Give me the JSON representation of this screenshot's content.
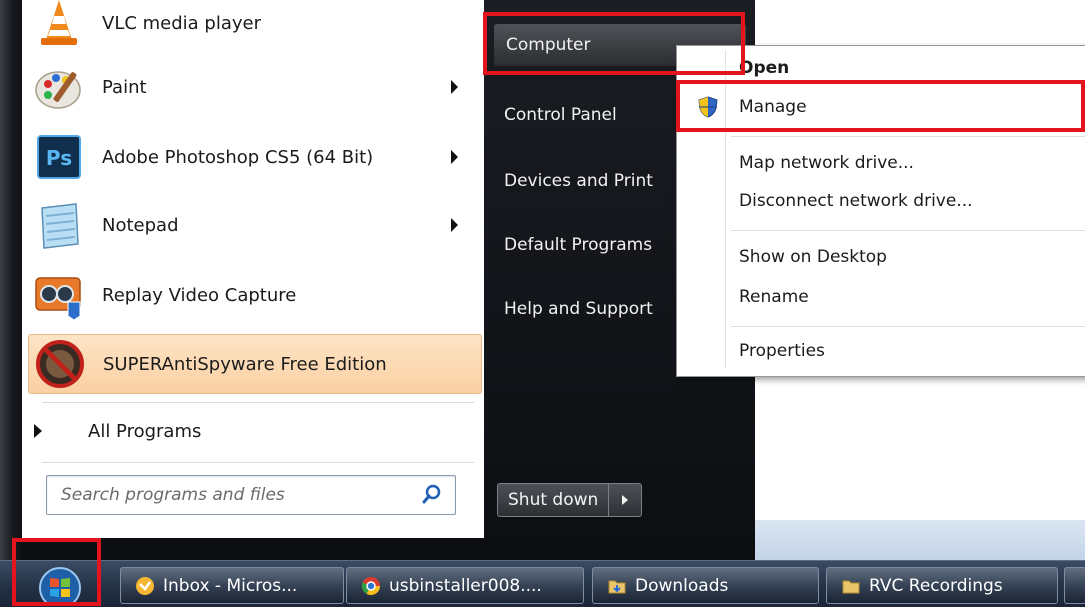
{
  "start_menu": {
    "programs": [
      {
        "label": "VLC media player",
        "icon": "vlc-icon",
        "has_submenu": false
      },
      {
        "label": "Paint",
        "icon": "paint-icon",
        "has_submenu": true
      },
      {
        "label": "Adobe Photoshop CS5 (64 Bit)",
        "icon": "photoshop-icon",
        "has_submenu": true
      },
      {
        "label": "Notepad",
        "icon": "notepad-icon",
        "has_submenu": true
      },
      {
        "label": "Replay Video Capture",
        "icon": "replay-video-capture-icon",
        "has_submenu": false
      },
      {
        "label": "SUPERAntiSpyware Free Edition",
        "icon": "superantispyware-icon",
        "has_submenu": false,
        "highlighted": true
      }
    ],
    "photoshop_badge": "Ps",
    "all_programs_label": "All Programs",
    "search": {
      "placeholder": "Search programs and files",
      "value": ""
    },
    "right_pane": {
      "items": [
        "Computer",
        "Control Panel",
        "Devices and Print",
        "Default Programs",
        "Help and Support"
      ],
      "shutdown_label": "Shut down"
    }
  },
  "context_menu": {
    "items": [
      "Open",
      "Manage",
      "Map network drive...",
      "Disconnect network drive...",
      "Show on Desktop",
      "Rename",
      "Properties"
    ]
  },
  "taskbar": {
    "buttons": [
      {
        "label": "Inbox - Micros...",
        "icon": "outlook-icon"
      },
      {
        "label": "usbinstaller008....",
        "icon": "chrome-icon"
      },
      {
        "label": "Downloads",
        "icon": "folder-icon"
      },
      {
        "label": "RVC Recordings",
        "icon": "folder-icon"
      }
    ]
  },
  "colors": {
    "highlight_box": "#e3141e",
    "menu_dark": "#1a1d22",
    "hover_orange": "#fbd0a3",
    "taskbar": "#243246"
  }
}
